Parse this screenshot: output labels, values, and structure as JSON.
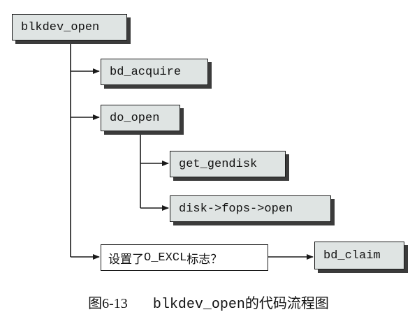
{
  "nodes": {
    "blkdev_open": "blkdev_open",
    "bd_acquire": "bd_acquire",
    "do_open": "do_open",
    "get_gendisk": "get_gendisk",
    "disk_fops_open": "disk->fops->open",
    "question_prefix": "设置了",
    "question_flag": "O_EXCL",
    "question_suffix": "标志？",
    "bd_claim": "bd_claim"
  },
  "caption": {
    "figure_number": "图6-13",
    "function_name": "blkdev_open",
    "suffix": "的代码流程图"
  },
  "colors": {
    "box_fill": "#dfe4e3",
    "box_shadow": "#3b3b3b",
    "line": "#1a1a1a"
  }
}
